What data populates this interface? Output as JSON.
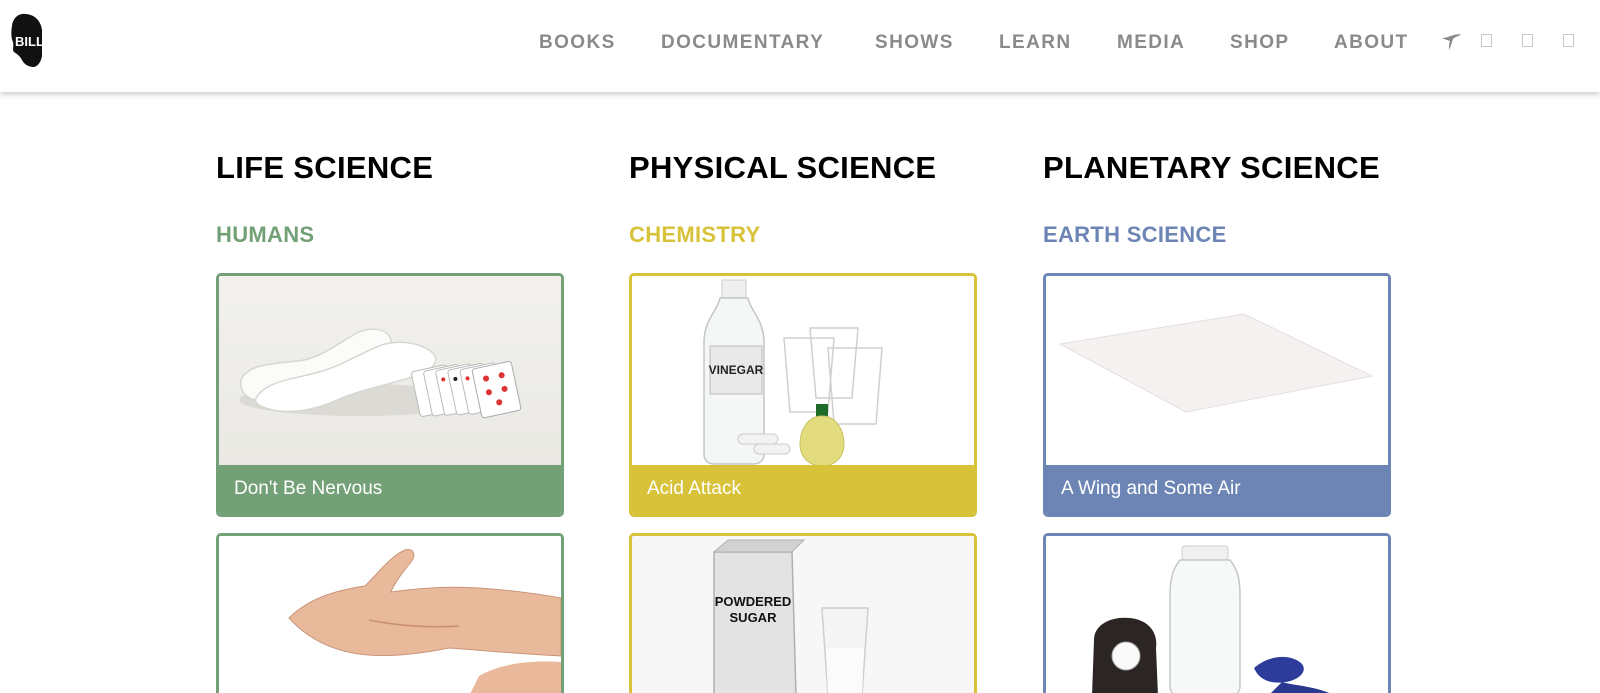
{
  "header": {
    "logo_text": "BILL NYE",
    "nav": [
      "BOOKS",
      "DOCUMENTARY",
      "SHOWS",
      "LEARN",
      "MEDIA",
      "SHOP",
      "ABOUT"
    ],
    "social_icons": [
      "twitter-bird-icon",
      "facebook-icon",
      "instagram-icon",
      "youtube-icon"
    ]
  },
  "columns": [
    {
      "title": "LIFE SCIENCE",
      "subtitle": "HUMANS",
      "accent": "#73a077",
      "cards": [
        {
          "caption": "Don't Be Nervous",
          "image": "socks-and-playing-cards-image"
        },
        {
          "caption": "",
          "image": "open-hand-image"
        }
      ]
    },
    {
      "title": "PHYSICAL SCIENCE",
      "subtitle": "CHEMISTRY",
      "accent": "#d8c23a",
      "cards": [
        {
          "caption": "Acid Attack",
          "image": "vinegar-cups-chalk-lemon-image",
          "label": "VINEGAR"
        },
        {
          "caption": "",
          "image": "powdered-sugar-box-and-glass-image",
          "label": "POWDERED SUGAR"
        }
      ]
    },
    {
      "title": "PLANETARY SCIENCE",
      "subtitle": "EARTH SCIENCE",
      "accent": "#6d85b5",
      "cards": [
        {
          "caption": "A Wing and Some Air",
          "image": "sheet-of-paper-image"
        },
        {
          "caption": "",
          "image": "jar-tape-and-scissors-image"
        }
      ]
    }
  ]
}
